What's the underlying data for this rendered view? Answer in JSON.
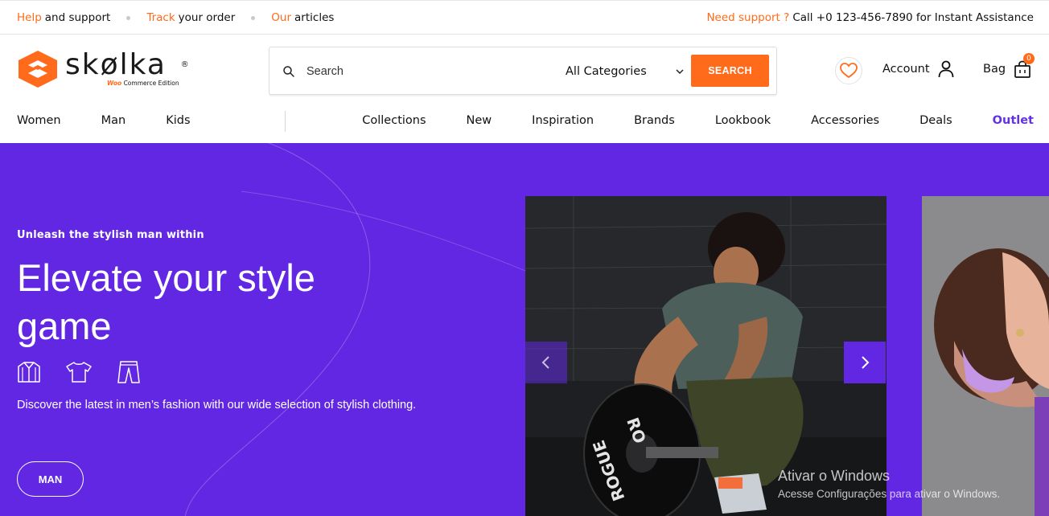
{
  "topbar": {
    "links": [
      {
        "accent": "Help",
        "text": "and support"
      },
      {
        "accent": "Track",
        "text": "your order"
      },
      {
        "accent": "Our",
        "text": "articles"
      }
    ],
    "support_accent": "Need support ?",
    "support_text": "Call +0 123-456-7890 for Instant Assistance"
  },
  "logo": {
    "word": "skølka",
    "reg": "®",
    "sub_woo": "Woo",
    "sub_text": "Commerce Edition"
  },
  "search": {
    "placeholder": "Search",
    "category": "All Categories",
    "button": "SEARCH"
  },
  "header": {
    "account_label": "Account",
    "bag_label": "Bag",
    "bag_count": "0"
  },
  "nav": {
    "left": [
      "Women",
      "Man",
      "Kids"
    ],
    "right": [
      "Collections",
      "New",
      "Inspiration",
      "Brands",
      "Lookbook",
      "Accessories",
      "Deals",
      "Outlet"
    ]
  },
  "hero": {
    "tag": "Unleash the stylish man within",
    "title": "Elevate your style game",
    "icons": [
      "shirt-icon",
      "tshirt-icon",
      "pants-icon"
    ],
    "description": "Discover the latest in men’s fashion with our wide selection of stylish clothing.",
    "cta": "MAN"
  },
  "watermark": {
    "line1": "Ativar o Windows",
    "line2": "Acesse Configurações para ativar o Windows."
  },
  "colors": {
    "accent": "#ff6b1a",
    "hero_bg": "#6127e2",
    "outlet": "#6432e0"
  }
}
